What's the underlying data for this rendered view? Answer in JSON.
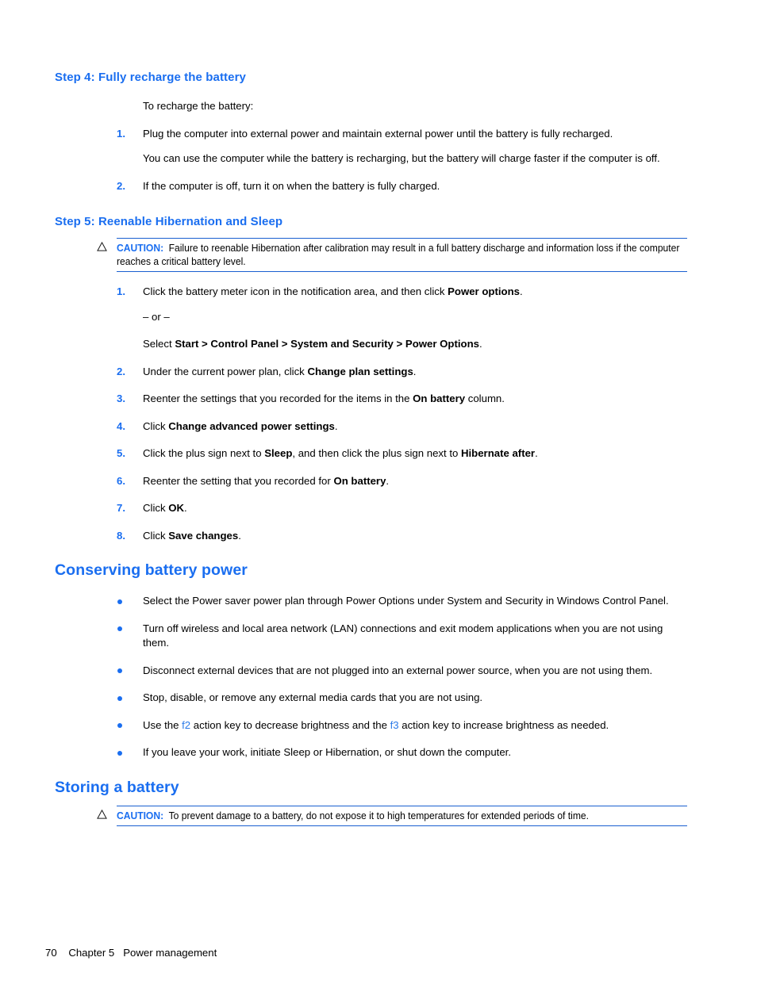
{
  "theme": {
    "heading_blue": "#1a6ef0",
    "rule_blue": "#1a5fd0",
    "xref_blue": "#2a7ae8",
    "body_black": "#000000",
    "page_background": "#ffffff"
  },
  "sections": {
    "step4": {
      "heading": "Step 4: Fully recharge the battery",
      "intro": "To recharge the battery:",
      "items": [
        {
          "marker": "1.",
          "text": "Plug the computer into external power and maintain external power until the battery is fully recharged."
        },
        {
          "marker": "2.",
          "text": "If the computer is off, turn it on when the battery is fully charged."
        }
      ],
      "note": "You can use the computer while the battery is recharging, but the battery will charge faster if the computer is off."
    },
    "step5": {
      "heading": "Step 5: Reenable Hibernation and Sleep",
      "caution": {
        "icon": "warning-triangle-icon",
        "label": "CAUTION:",
        "text": "Failure to reenable Hibernation after calibration may result in a full battery discharge and information loss if the computer reaches a critical battery level."
      },
      "items": [
        {
          "marker": "1.",
          "pre": "Click the battery meter icon in the notification area, and then click ",
          "bold": "Power options",
          "post": "."
        },
        {
          "marker": "2.",
          "pre": "Under the current power plan, click ",
          "bold": "Change plan settings",
          "post": "."
        },
        {
          "marker": "3.",
          "pre": "Reenter the settings that you recorded for the items in the ",
          "bold": "On battery",
          "post": " column."
        },
        {
          "marker": "4.",
          "pre": "Click ",
          "bold": "Change advanced power settings",
          "post": "."
        },
        {
          "marker": "5.",
          "pre": "Click the plus sign next to ",
          "bold": "Sleep",
          "mid": ", and then click the plus sign next to ",
          "bold2": "Hibernate after",
          "post": "."
        },
        {
          "marker": "6.",
          "pre": "Reenter the setting that you recorded for ",
          "bold": "On battery",
          "post": "."
        },
        {
          "marker": "7.",
          "pre": "Click ",
          "bold": "OK",
          "post": "."
        },
        {
          "marker": "8.",
          "pre": "Click ",
          "bold": "Save changes",
          "post": "."
        }
      ],
      "or_separator": "– or –",
      "alt_path": {
        "pre": "Select ",
        "bold": "Start > Control Panel > System and Security > Power Options",
        "post": "."
      }
    },
    "conserving": {
      "heading": "Conserving battery power",
      "bullets": [
        {
          "marker": "•",
          "text": "Select the Power saver power plan through Power Options under System and Security in Windows Control Panel."
        },
        {
          "marker": "•",
          "text": "Turn off wireless and local area network (LAN) connections and exit modem applications when you are not using them."
        },
        {
          "marker": "•",
          "text": "Disconnect external devices that are not plugged into an external power source, when you are not using them."
        },
        {
          "marker": "•",
          "text": "Stop, disable, or remove any external media cards that you are not using."
        },
        {
          "marker": "•",
          "pre": "Use the ",
          "xref1": "f2",
          "mid": " action key to decrease brightness and the ",
          "xref2": "f3",
          "post": " action key to increase brightness as needed."
        },
        {
          "marker": "•",
          "text": "If you leave your work, initiate Sleep or Hibernation, or shut down the computer."
        }
      ]
    },
    "storing": {
      "heading": "Storing a battery",
      "caution": {
        "icon": "warning-triangle-icon",
        "label": "CAUTION:",
        "text": "To prevent damage to a battery, do not expose it to high temperatures for extended periods of time."
      }
    }
  },
  "footer": {
    "page_number": "70",
    "chapter": "Chapter 5",
    "chapter_title": "Power management",
    "combined": "70    Chapter 5   Power management"
  }
}
